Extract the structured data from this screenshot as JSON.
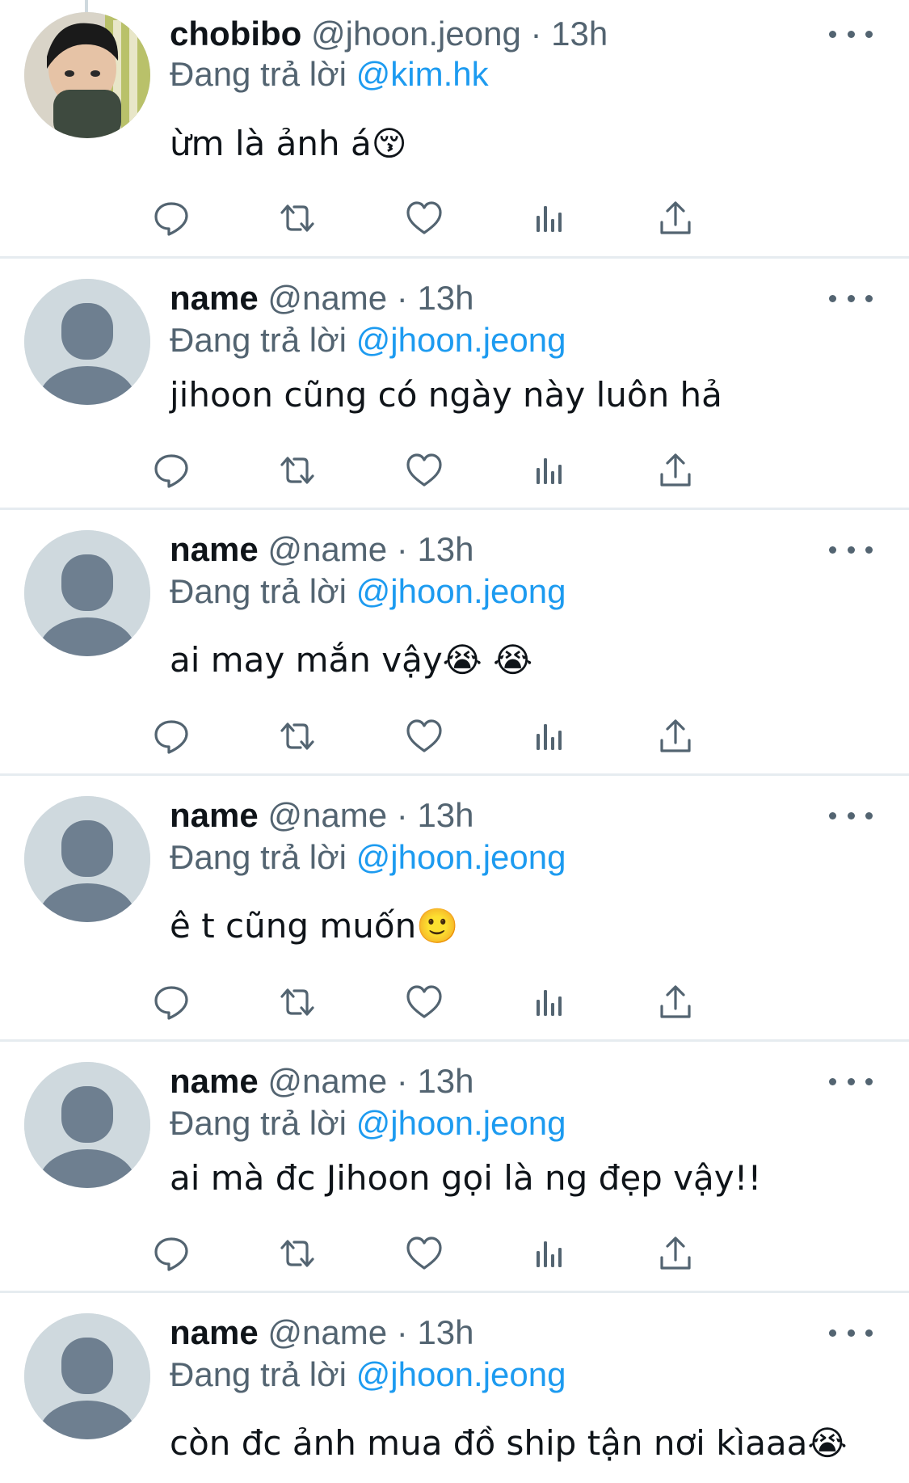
{
  "tweets": [
    {
      "name": "chobibo",
      "handle": "@jhoon.jeong",
      "dot": "·",
      "time": "13h",
      "reply_prefix": "Đang trả lời ",
      "reply_to": "@kim.hk",
      "text": "ừm là ảnh á😚",
      "avatar": "photo-avatar"
    },
    {
      "name": "name",
      "handle": "@name",
      "dot": "·",
      "time": "13h",
      "reply_prefix": "Đang trả lời ",
      "reply_to": "@jhoon.jeong",
      "text": "jihoon cũng có ngày này luôn hả",
      "avatar": "default-avatar"
    },
    {
      "name": "name",
      "handle": "@name",
      "dot": "·",
      "time": "13h",
      "reply_prefix": "Đang trả lời ",
      "reply_to": "@jhoon.jeong",
      "text": "ai may mắn vậy😭 😭",
      "avatar": "default-avatar"
    },
    {
      "name": "name",
      "handle": "@name",
      "dot": "·",
      "time": "13h",
      "reply_prefix": "Đang trả lời ",
      "reply_to": "@jhoon.jeong",
      "text": "ê t cũng muốn🙂",
      "avatar": "default-avatar"
    },
    {
      "name": "name",
      "handle": "@name",
      "dot": "·",
      "time": "13h",
      "reply_prefix": "Đang trả lời ",
      "reply_to": "@jhoon.jeong",
      "text": "ai mà đc Jihoon gọi là ng đẹp vậy!!",
      "avatar": "default-avatar"
    },
    {
      "name": "name",
      "handle": "@name",
      "dot": "·",
      "time": "13h",
      "reply_prefix": "Đang trả lời ",
      "reply_to": "@jhoon.jeong",
      "text": "còn đc ảnh mua đồ ship tận nơi kìaaa😭",
      "avatar": "default-avatar"
    }
  ],
  "actions": [
    "reply-icon",
    "retweet-icon",
    "like-icon",
    "views-icon",
    "share-icon"
  ],
  "colors": {
    "link": "#1d9bf0",
    "muted": "#536471",
    "divider": "#e6ecf0",
    "avatar_bg": "#cfd9de",
    "avatar_fg": "#6e7f90"
  }
}
